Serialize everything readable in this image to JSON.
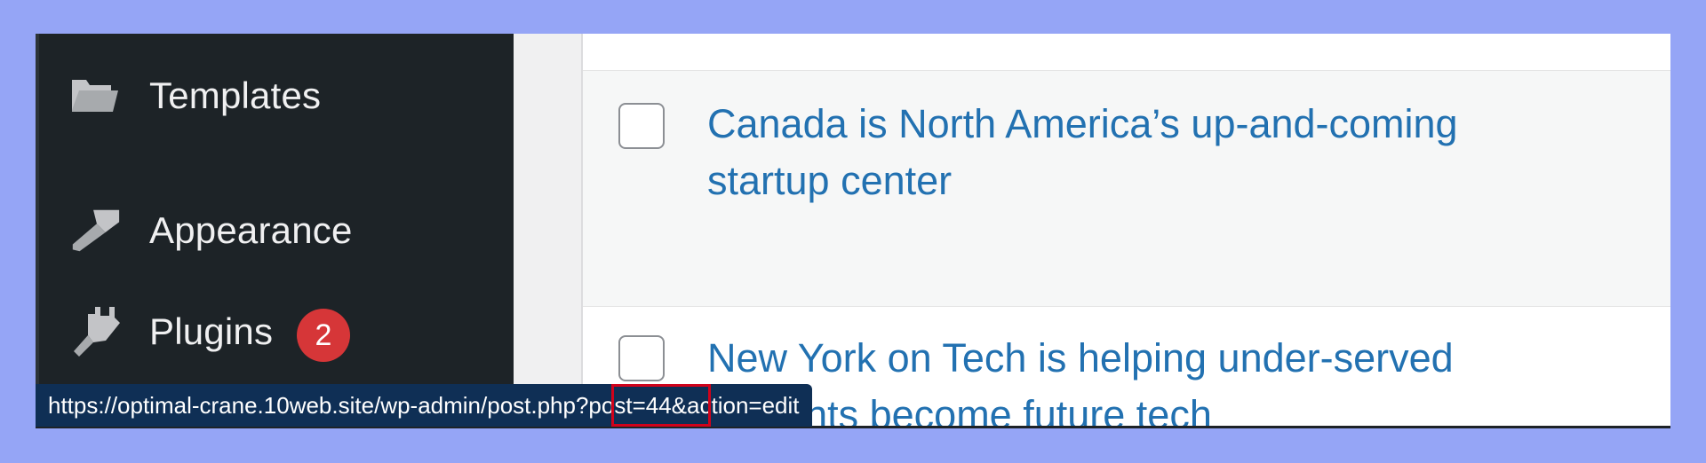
{
  "sidebar": {
    "items": [
      {
        "label": "Templates",
        "icon": "folder-open-icon"
      },
      {
        "label": "Appearance",
        "icon": "paintbrush-icon"
      },
      {
        "label": "Plugins",
        "icon": "plugin-icon",
        "badge": "2"
      }
    ]
  },
  "posts": {
    "rows": [
      {
        "title": "Canada is North America’s up-and-coming startup center",
        "checked": false
      },
      {
        "title": "New York on Tech is helping under-served students become future tech",
        "checked": false
      }
    ]
  },
  "status_bar": {
    "url": "https://optimal-crane.10web.site/wp-admin/post.php?post=44&action=edit"
  },
  "colors": {
    "sidebar_bg": "#1d2327",
    "link": "#2271b1",
    "badge": "#d63638",
    "status_bg": "#0f2f55",
    "highlight": "#d0021b",
    "backdrop": "#95a5f6"
  }
}
